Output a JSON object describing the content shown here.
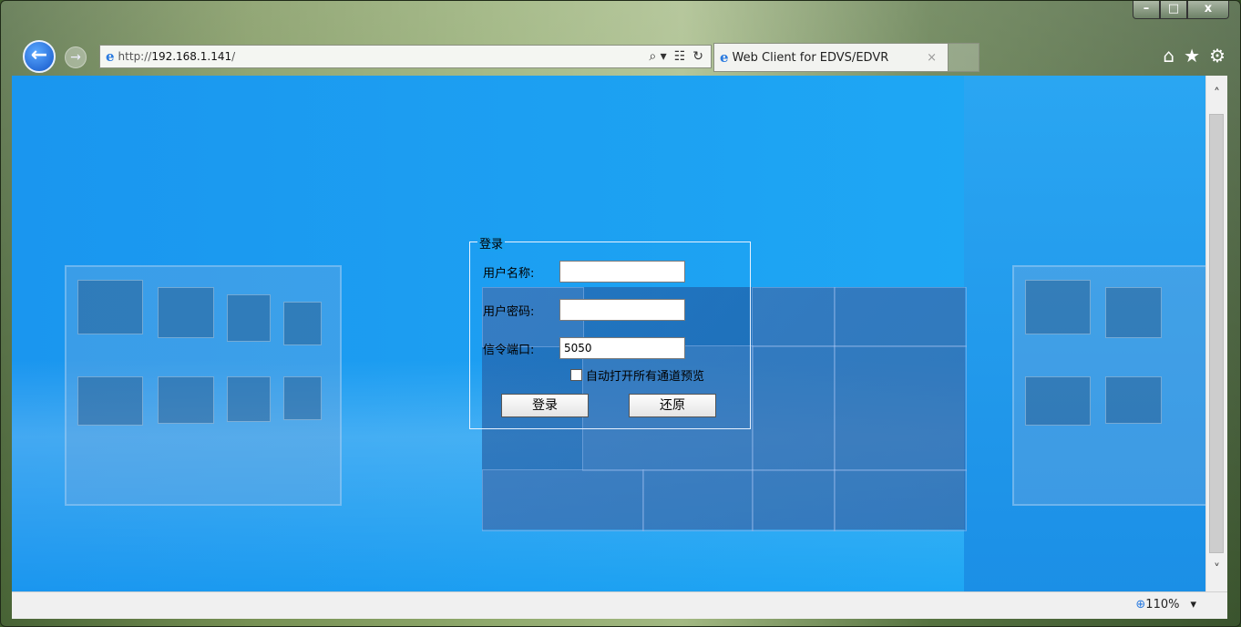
{
  "window": {
    "caption": {
      "minimize": "–",
      "maximize": "□",
      "close": "x"
    }
  },
  "nav": {
    "back_glyph": "←",
    "forward_glyph": "→",
    "address": {
      "scheme": "http://",
      "host": "192.168.1.141",
      "path": "/"
    },
    "search_glyph": "⌕ ▾",
    "compat_glyph": "☷",
    "refresh_glyph": "↻"
  },
  "tab": {
    "title": "Web Client for EDVS/EDVR",
    "close_glyph": "×"
  },
  "commands": {
    "home": "⌂",
    "favorites": "★",
    "tools": "⚙"
  },
  "login": {
    "legend": "登录",
    "username_label": "用户名称:",
    "username_value": "",
    "password_label": "用户密码:",
    "password_value": "",
    "port_label": "信令端口:",
    "port_value": "5050",
    "auto_open_label": "自动打开所有通道预览",
    "auto_open_checked": false,
    "login_button": "登录",
    "reset_button": "还原"
  },
  "scrollbar": {
    "up_glyph": "˄",
    "down_glyph": "˅"
  },
  "status": {
    "zoom": "110%",
    "zoom_dropdown_glyph": "▾"
  },
  "icons": {
    "back": "back-arrow-icon",
    "forward": "forward-arrow-icon",
    "ie": "internet-explorer-icon",
    "search": "search-icon",
    "compat": "compatibility-view-icon",
    "refresh": "refresh-icon",
    "home": "home-icon",
    "favorites": "favorites-star-icon",
    "tools": "gear-icon",
    "zoom": "zoom-magnifier-icon"
  }
}
